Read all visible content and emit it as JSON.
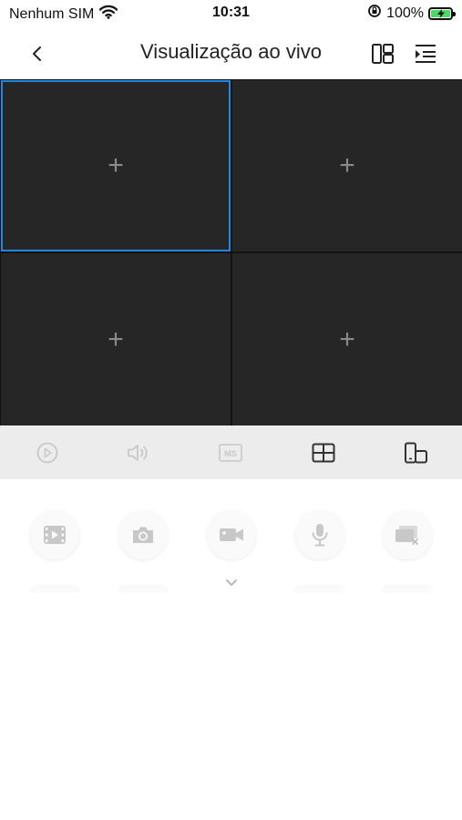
{
  "status_bar": {
    "carrier": "Nenhum SIM",
    "time": "10:31",
    "battery": "100%"
  },
  "nav": {
    "title": "Visualização ao vivo",
    "icons": [
      "back-icon",
      "layout-icon",
      "device-list-icon"
    ]
  },
  "grid": {
    "cells": [
      {
        "label": "+",
        "selected": true
      },
      {
        "label": "+",
        "selected": false
      },
      {
        "label": "+",
        "selected": false
      },
      {
        "label": "+",
        "selected": false
      }
    ]
  },
  "control_bar": {
    "icons": [
      "play-icon",
      "volume-icon",
      "stream-quality-icon",
      "split-screen-icon",
      "rotate-screen-icon"
    ],
    "stream_badge": "MS"
  },
  "tools": {
    "icons": [
      "playback-icon",
      "snapshot-icon",
      "record-icon",
      "talk-icon",
      "close-all-icon"
    ]
  },
  "colors": {
    "accent": "#1e88e5",
    "grid_bg": "#262626",
    "control_bar_bg": "#ececec",
    "icon_active": "#333333",
    "icon_disabled": "#c8c8c8"
  }
}
